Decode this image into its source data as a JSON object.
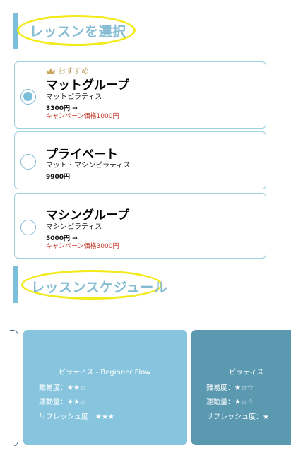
{
  "sections": {
    "lesson_select_title": "レッスンを選択",
    "schedule_title": "レッスンスケジュール"
  },
  "lessons": [
    {
      "badge": "おすすめ",
      "name": "マットグループ",
      "sub": "マットピラティス",
      "price": "3300円 →",
      "campaign": "キャンペーン価格1000円",
      "selected": true
    },
    {
      "name": "プライベート",
      "sub": "マット・マシンピラティス",
      "price": "9900円",
      "selected": false
    },
    {
      "name": "マシングループ",
      "sub": "マシンピラティス",
      "price": "5000円 →",
      "campaign": "キャンペーン価格3000円",
      "selected": false
    }
  ],
  "schedule": [
    {
      "title": "ピラティス - Beginner Flow",
      "difficulty": "難易度：★★☆",
      "exercise": "運動量：★★☆",
      "refresh": "リフレッシュ度：★★★"
    },
    {
      "title": "ピラティス",
      "difficulty": "難易度：★☆☆",
      "exercise": "運動量：★☆☆",
      "refresh": "リフレッシュ度：★"
    }
  ],
  "colors": {
    "accent": "#7cbfd9",
    "campaign_red": "#c23a2c",
    "badge_gold": "#b89a55",
    "highlight_yellow": "#f2ea1a"
  },
  "icons": {
    "recommend": "crown-icon"
  }
}
